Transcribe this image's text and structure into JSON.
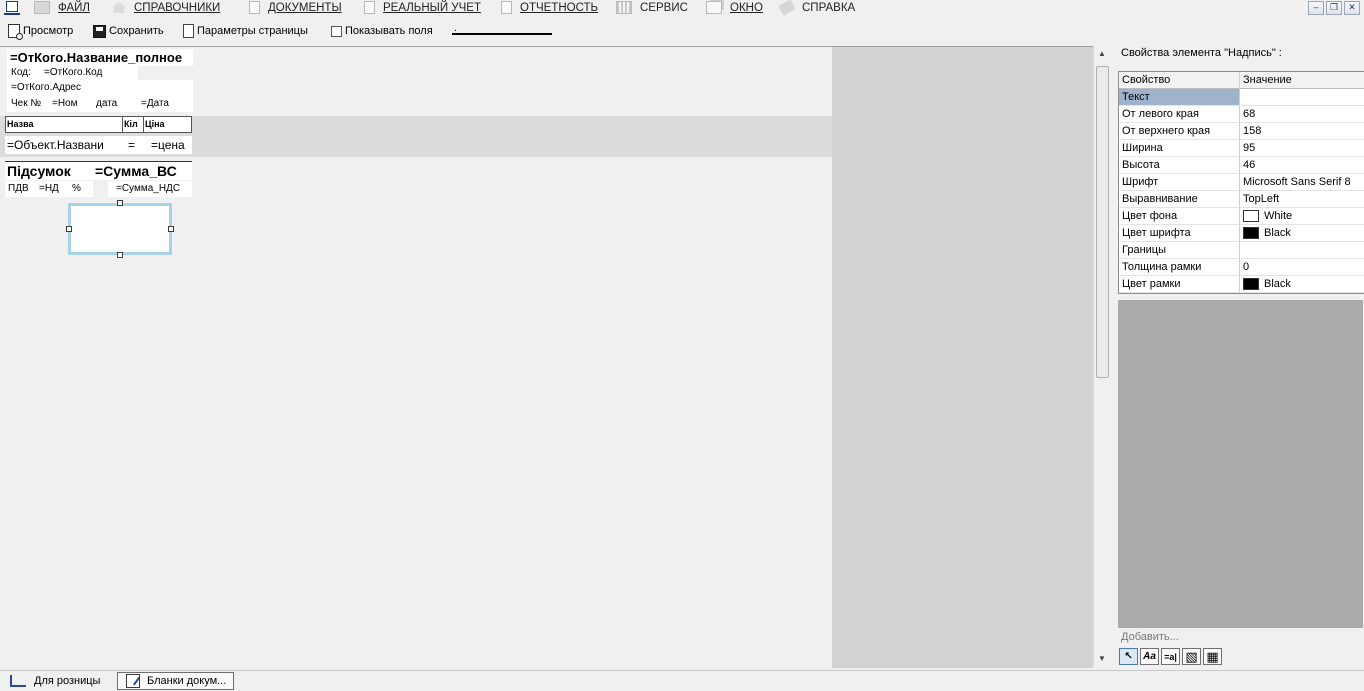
{
  "menu": [
    {
      "label": "ФАЙЛ",
      "icon": "folder-icon",
      "underline": true
    },
    {
      "label": "СПРАВОЧНИКИ",
      "icon": "home-icon",
      "underline": true
    },
    {
      "label": "ДОКУМЕНТЫ",
      "icon": "document-icon",
      "underline": true
    },
    {
      "label": "РЕАЛЬНЫЙ УЧЕТ",
      "icon": "document-icon",
      "underline": true
    },
    {
      "label": "ОТЧЕТНОСТЬ",
      "icon": "report-icon",
      "underline": true
    },
    {
      "label": "СЕРВИС",
      "icon": "grid-icon",
      "underline": false
    },
    {
      "label": "ОКНО",
      "icon": "window-icon",
      "underline": true
    },
    {
      "label": "СПРАВКА",
      "icon": "help-icon",
      "underline": false
    }
  ],
  "window_controls": {
    "minimize": "–",
    "restore": "❐",
    "close": "✕"
  },
  "toolbar": {
    "preview": "Просмотр",
    "save": "Сохранить",
    "page_params": "Параметры страницы",
    "show_fields": "Показывать поля",
    "dropdown_value": "."
  },
  "report": {
    "org_name": "=ОтКого.Название_полное",
    "code_label": "Код:",
    "code_value": "=ОтКого.Код",
    "address": "=ОтКого.Адрес",
    "receipt_label": "Чек №",
    "receipt_number": "=Ном",
    "date_label": "дата",
    "date_value": "=Дата",
    "col_name": "Назва",
    "col_qty": "Кіл",
    "col_price": "Ціна",
    "item_name": "=Объект.Названи",
    "item_qty": "=",
    "item_price": "=цена",
    "total_label": "Підсумок",
    "total_value": "=Сумма_ВС",
    "vat_label": "ПДВ",
    "vat_value": "=НД",
    "vat_percent": "%",
    "vat_amount": "=Сумма_НДС"
  },
  "properties": {
    "title": "Свойства элемента \"Надпись\" :",
    "col_property": "Свойство",
    "col_value": "Значение",
    "rows": [
      {
        "name": "Текст",
        "value": "",
        "selected": true
      },
      {
        "name": "От левого края",
        "value": "68"
      },
      {
        "name": "От верхнего края",
        "value": "158"
      },
      {
        "name": "Ширина",
        "value": "95"
      },
      {
        "name": "Высота",
        "value": "46"
      },
      {
        "name": "Шрифт",
        "value": "Microsoft Sans Serif 8"
      },
      {
        "name": "Выравнивание",
        "value": "TopLeft"
      },
      {
        "name": "Цвет фона",
        "value": "White",
        "swatch": "#ffffff"
      },
      {
        "name": "Цвет шрифта",
        "value": "Black",
        "swatch": "#000000"
      },
      {
        "name": "Границы",
        "value": ""
      },
      {
        "name": "Толщина рамки",
        "value": "0"
      },
      {
        "name": "Цвет рамки",
        "value": "Black",
        "swatch": "#000000"
      }
    ],
    "add_label": "Добавить...",
    "tools": [
      {
        "name": "pointer-tool",
        "glyph": "↖"
      },
      {
        "name": "label-tool",
        "glyph": "Aa"
      },
      {
        "name": "field-tool",
        "glyph": "=a|"
      },
      {
        "name": "image-tool",
        "glyph": "▧"
      },
      {
        "name": "table-tool",
        "glyph": "▦"
      }
    ]
  },
  "taskbar": {
    "items": [
      {
        "label": "Для розницы",
        "active": false
      },
      {
        "label": "Бланки докум...",
        "active": true
      }
    ]
  },
  "colors": {
    "selection_border": "#a9d3e9",
    "selected_row": "#9fb3cd",
    "panel_gray": "#ababab",
    "canvas_dark": "#d3d3d3"
  }
}
